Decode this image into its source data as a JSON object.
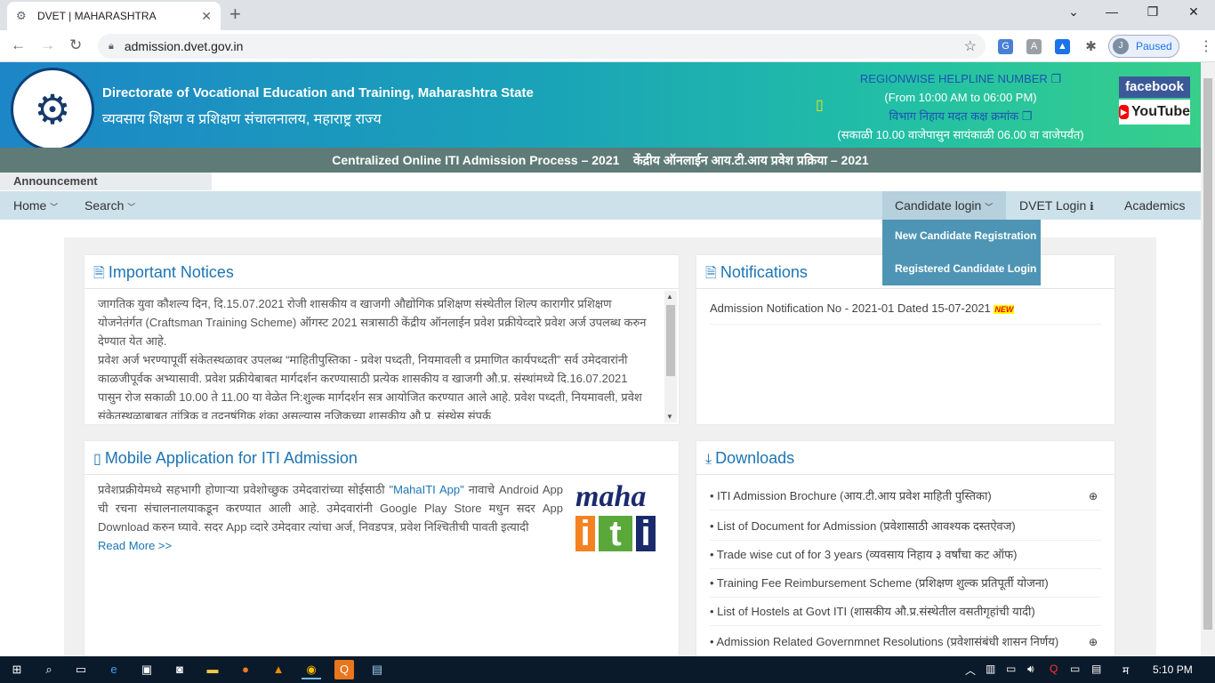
{
  "browser": {
    "tab_title": "DVET | MAHARASHTRA",
    "url": "admission.dvet.gov.in",
    "profile_initial": "J",
    "profile_status": "Paused"
  },
  "header": {
    "org_name_en": "Directorate of Vocational Education and Training, Maharashtra State",
    "org_name_mr": "व्यवसाय शिक्षण व प्रशिक्षण संचालनालय, महाराष्ट्र राज्य",
    "helpline_title": "REGIONWISE HELPLINE NUMBER",
    "helpline_hours": "(From 10:00 AM to 06:00 PM)",
    "helpline_title_mr": "विभाग निहाय मदत कक्ष क्रमांक",
    "helpline_hours_mr": "(सकाळी 10.00 वाजेपासुन सायंकाळी 06.00 वा वाजेपर्यंत)",
    "facebook": "facebook",
    "youtube": "YouTube",
    "process_title": "Centralized Online ITI Admission Process – 2021    केंद्रीय ऑनलाईन आय.टी.आय प्रवेश प्रक्रिया – 2021"
  },
  "announcement_label": "Announcement",
  "nav": {
    "home": "Home",
    "search": "Search",
    "candidate_login": "Candidate login",
    "dvet_login": "DVET Login",
    "academics": "Academics",
    "dropdown": [
      "New Candidate Registration",
      "Registered Candidate Login"
    ]
  },
  "notices": {
    "title": "Important Notices",
    "p1": "जागतिक युवा कौशल्य दिन, दि.15.07.2021 रोजी शासकीय व खाजगी औद्योगिक प्रशिक्षण संस्थेतील शिल्प कारागीर प्रशिक्षण योजनेतंर्गत (Craftsman Training Scheme) ऑगस्ट 2021 सत्रासाठी केंद्रीय ऑनलाईन प्रवेश प्रक्रीयेव्दारे प्रवेश अर्ज उपलब्ध करुन देण्यात येत आहे.",
    "p2": "प्रवेश अर्ज भरण्यापूर्वी संकेतस्थळावर उपलब्ध “माहितीपुस्तिका - प्रवेश पध्दती, नियमावली व प्रमाणित कार्यपध्दती” सर्व उमेदवारांनी काळजीपूर्वक अभ्यासावी. प्रवेश प्रक्रीयेबाबत मार्गदर्शन करण्यासाठी प्रत्येक शासकीय व खाजगी औ.प्र. संस्थांमध्ये दि.16.07.2021 पासुन रोज सकाळी 10.00 ते 11.00 या वेळेत नि:शुल्क मार्गदर्शन सत्र आयोजित करण्यात आले आहे. प्रवेश पध्दती, नियमावली, प्रवेश संकेतस्थळाबाबत तांत्रिक व तद्नुषंगिक शंका असल्यास नजिकच्या शासकीय औ.प्र. संस्थेस संपर्क"
  },
  "notifications": {
    "title": "Notifications",
    "items": [
      "Admission Notification No - 2021-01 Dated 15-07-2021"
    ],
    "new_badge": "NEW"
  },
  "mobile_app": {
    "title": "Mobile Application for ITI Admission",
    "text_before": "प्रवेशप्रक्रीयेमध्ये सहभागी होणाऱ्या प्रवेशोच्छुक उमेदवारांच्या सोईसाठी ",
    "app_name": "\"MahaITI App\"",
    "text_after": " नावाचे Android App ची रचना संचालनालयाकडून करण्यात आली आहे. उमेदवारांनी Google Play Store मधुन सदर App Download करुन घ्यावे. सदर App व्दारे उमेदवार त्यांचा अर्ज, निवडपत्र, प्रवेश निश्चितीची पावती इत्यादी",
    "read_more": "Read More >>",
    "logo_top": "maha",
    "logo_letters": [
      "i",
      "t",
      "i"
    ]
  },
  "downloads": {
    "title": "Downloads",
    "items": [
      "• ITI Admission Brochure (आय.टी.आय प्रवेश माहिती पुस्तिका)",
      "• List of Document for Admission (प्रवेशासाठी आवश्यक दस्तऐवज)",
      "• Trade wise cut of for 3 years (व्यवसाय निहाय ३ वर्षांचा कट ऑफ)",
      "• Training Fee Reimbursement Scheme (प्रशिक्षण शुल्क प्रतिपूर्ती योजना)",
      "• List of Hostels at Govt ITI (शासकीय औ.प्र.संस्थेतील वसतीगृहांची यादी)",
      "• Admission Related Governmnet Resolutions (प्रवेशासंबंधी शासन निर्णय)"
    ]
  },
  "taskbar": {
    "language": "म",
    "time": "5:10 PM"
  },
  "colors": {
    "accent": "#1d75b5",
    "navbar": "#cde1ea",
    "titlebar": "#5f7b78",
    "dropdown": "#4e95b5"
  }
}
